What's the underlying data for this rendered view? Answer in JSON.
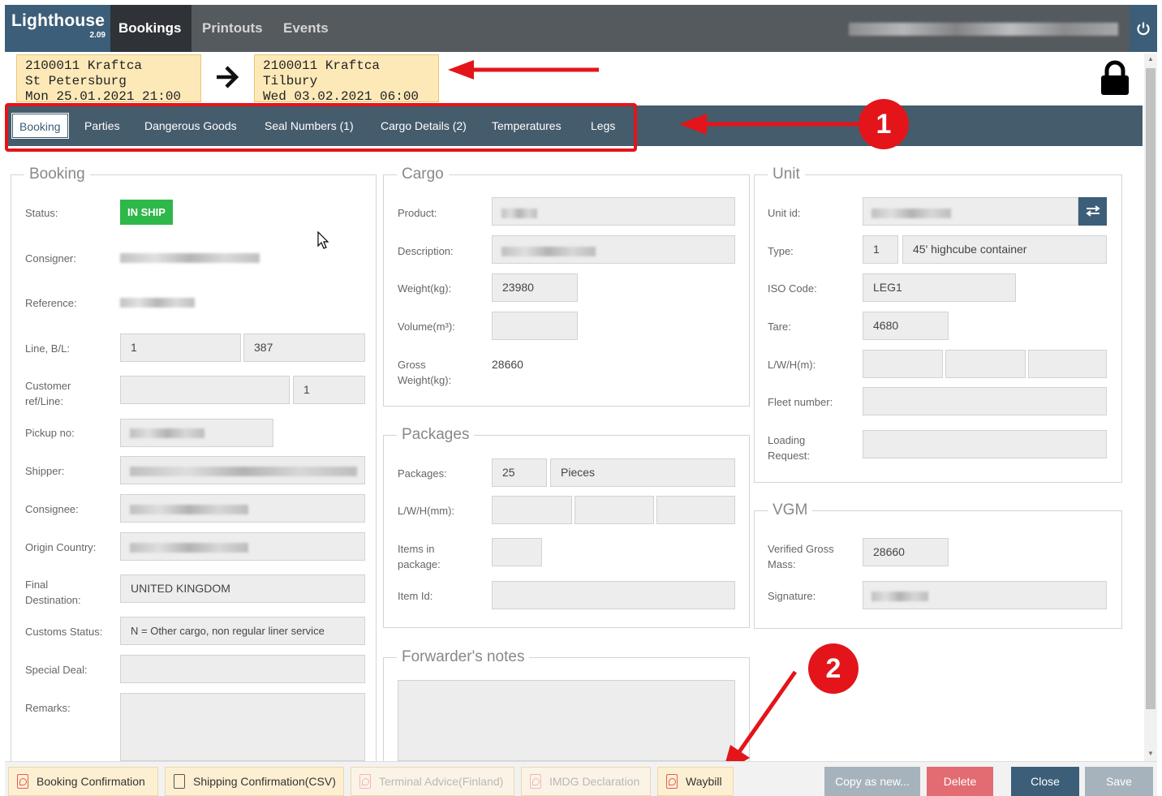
{
  "app": {
    "name": "Lighthouse",
    "version": "2.09"
  },
  "nav": {
    "items": [
      "Bookings",
      "Printouts",
      "Events"
    ]
  },
  "route": {
    "from": {
      "line1": "2100011 Kraftca",
      "line2": "St Petersburg",
      "line3": "Mon 25.01.2021 21:00"
    },
    "to": {
      "line1": "2100011 Kraftca",
      "line2": "Tilbury",
      "line3": "Wed 03.02.2021 06:00"
    }
  },
  "tabs": [
    "Booking",
    "Parties",
    "Dangerous Goods",
    "Seal Numbers (1)",
    "Cargo Details (2)",
    "Temperatures",
    "Legs"
  ],
  "annotations": {
    "badge1": "1",
    "badge2": "2"
  },
  "booking": {
    "title": "Booking",
    "status_label": "Status:",
    "status_value": "IN SHIP",
    "consigner_label": "Consigner:",
    "reference_label": "Reference:",
    "line_bl_label": "Line, B/L:",
    "line_value": "1",
    "bl_value": "387",
    "customer_ref_label": "Customer ref/Line:",
    "customer_line_value": "1",
    "pickup_label": "Pickup no:",
    "shipper_label": "Shipper:",
    "consignee_label": "Consignee:",
    "origin_label": "Origin Country:",
    "final_dest_label": "Final Destination:",
    "final_dest_value": "UNITED KINGDOM",
    "customs_label": "Customs Status:",
    "customs_value": "N = Other cargo, non regular liner service",
    "special_deal_label": "Special Deal:",
    "remarks_label": "Remarks:"
  },
  "cargo": {
    "title": "Cargo",
    "product_label": "Product:",
    "description_label": "Description:",
    "weight_label": "Weight(kg):",
    "weight_value": "23980",
    "volume_label": "Volume(m³):",
    "gross_label": "Gross Weight(kg):",
    "gross_value": "28660"
  },
  "packages": {
    "title": "Packages",
    "packages_label": "Packages:",
    "count": "25",
    "kind": "Pieces",
    "lwh_label": "L/W/H(mm):",
    "items_label": "Items in package:",
    "item_id_label": "Item Id:"
  },
  "forwarder": {
    "title": "Forwarder's notes"
  },
  "unit": {
    "title": "Unit",
    "unit_id_label": "Unit id:",
    "type_label": "Type:",
    "type_code": "1",
    "type_name": "45' highcube container",
    "iso_label": "ISO Code:",
    "iso_value": "LEG1",
    "tare_label": "Tare:",
    "tare_value": "4680",
    "lwh_label": "L/W/H(m):",
    "fleet_label": "Fleet number:",
    "loading_label": "Loading Request:"
  },
  "vgm": {
    "title": "VGM",
    "vgm_label": "Verified Gross Mass:",
    "vgm_value": "28660",
    "signature_label": "Signature:"
  },
  "footer": {
    "docs": [
      "Booking Confirmation",
      "Shipping Confirmation(CSV)",
      "Terminal Advice(Finland)",
      "IMDG Declaration",
      "Waybill"
    ],
    "copy": "Copy as new...",
    "delete": "Delete",
    "close": "Close",
    "save": "Save"
  },
  "colors": {
    "brand": "#3c5e78",
    "tabbar": "#455c6c",
    "status_green": "#2eb84a",
    "delete_red": "#e36b72",
    "annotation_red": "#e3151a"
  }
}
